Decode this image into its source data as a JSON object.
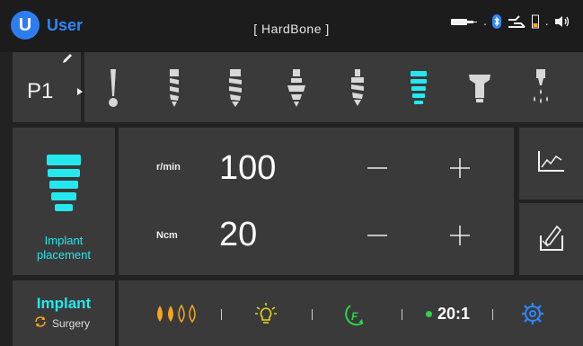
{
  "header": {
    "avatar_letter": "U",
    "user_name": "User",
    "bone_mode": "[ HardBone ]",
    "status_icons": [
      "battery-icon",
      "bluetooth-icon",
      "connection-icon",
      "power-level-icon",
      "speaker-icon"
    ]
  },
  "program": {
    "label": "P1",
    "edit_icon": "pencil-icon",
    "arrow_icon": "play-arrow-icon"
  },
  "tools": [
    {
      "name": "pilot-drill-icon",
      "selected": false
    },
    {
      "name": "drill-2-icon",
      "selected": false
    },
    {
      "name": "drill-3-icon",
      "selected": false
    },
    {
      "name": "countersink-icon",
      "selected": false
    },
    {
      "name": "tap-icon",
      "selected": false
    },
    {
      "name": "implant-icon",
      "selected": true
    },
    {
      "name": "abutment-icon",
      "selected": false
    },
    {
      "name": "irrigation-icon",
      "selected": false
    }
  ],
  "step": {
    "line1": "Implant",
    "line2": "placement",
    "icon": "implant-icon"
  },
  "params": [
    {
      "unit": "r/min",
      "value": "100",
      "minus": "−",
      "plus": "+"
    },
    {
      "unit": "Ncm",
      "value": "20",
      "minus": "−",
      "plus": "+"
    }
  ],
  "side_buttons": {
    "graph_icon": "graph-icon",
    "dip_icon": "dip-tube-icon"
  },
  "mode": {
    "title": "Implant",
    "subtitle": "Surgery",
    "sync_icon": "sync-icon"
  },
  "bottom": {
    "irrigation_level": "2 of 4 drops",
    "light_icon": "light-bulb-icon",
    "forward_icon": "forward-rotation-icon",
    "forward_letter": "F",
    "ratio": "20:1",
    "settings_icon": "settings-gear-icon"
  },
  "colors": {
    "accent_cyan": "#25e8ef",
    "accent_blue": "#2e88ff",
    "drop_orange": "#f6a51d",
    "light_yellow": "#e8d81a",
    "forward_green": "#2cd44a"
  }
}
